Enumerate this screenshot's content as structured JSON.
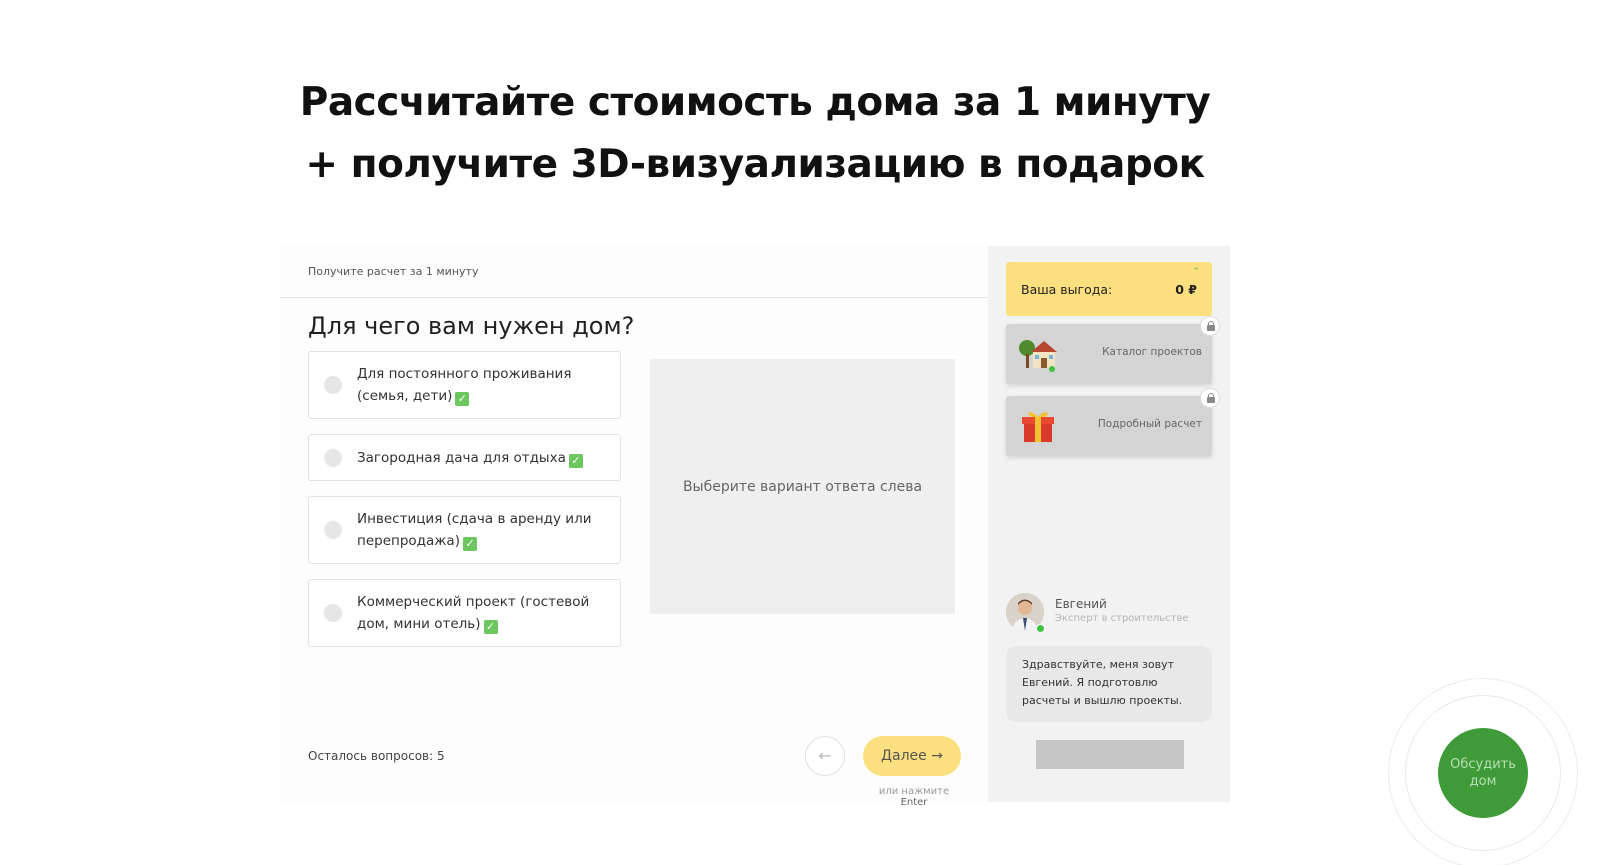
{
  "headline": {
    "line1": "Рассчитайте стоимость дома за 1 минуту",
    "line2": "+ получите 3D-визуализацию в подарок"
  },
  "quiz": {
    "subtitle": "Получите расчет за 1 минуту",
    "question": "Для чего вам нужен дом?",
    "options": [
      {
        "label": "Для постоянного проживания (семья, дети)",
        "icon": "check-mark-icon"
      },
      {
        "label": "Загородная дача для отдыха",
        "icon": "check-mark-icon"
      },
      {
        "label": "Инвестиция (сдача в аренду или перепродажа)",
        "icon": "check-mark-icon"
      },
      {
        "label": "Коммерческий проект (гостевой дом, мини отель)",
        "icon": "check-mark-icon"
      }
    ],
    "preview_placeholder": "Выберите вариант ответа слева",
    "remaining": "Осталось вопросов: 5",
    "back_icon": "←",
    "next_label": "Далее",
    "next_icon": "→",
    "hint_prefix": "или нажмите",
    "hint_key": "Enter"
  },
  "sidebar": {
    "benefit_label": "Ваша выгода:",
    "benefit_value": "0 ₽",
    "bonuses": [
      {
        "label": "Каталог проектов",
        "icon": "house-icon",
        "locked": true
      },
      {
        "label": "Подробный расчет",
        "icon": "gift-icon",
        "locked": true
      }
    ],
    "expert": {
      "name": "Евгений",
      "role": "Эксперт в строительстве",
      "message": "Здравствуйте, меня зовут Евгений. Я подготовлю расчеты и вышлю проекты."
    }
  },
  "floating": {
    "discuss_label": "Обсудить дом"
  },
  "colors": {
    "accent_yellow": "#fcdf7e",
    "green": "#3f9b37",
    "check_green": "#6cc75e"
  }
}
